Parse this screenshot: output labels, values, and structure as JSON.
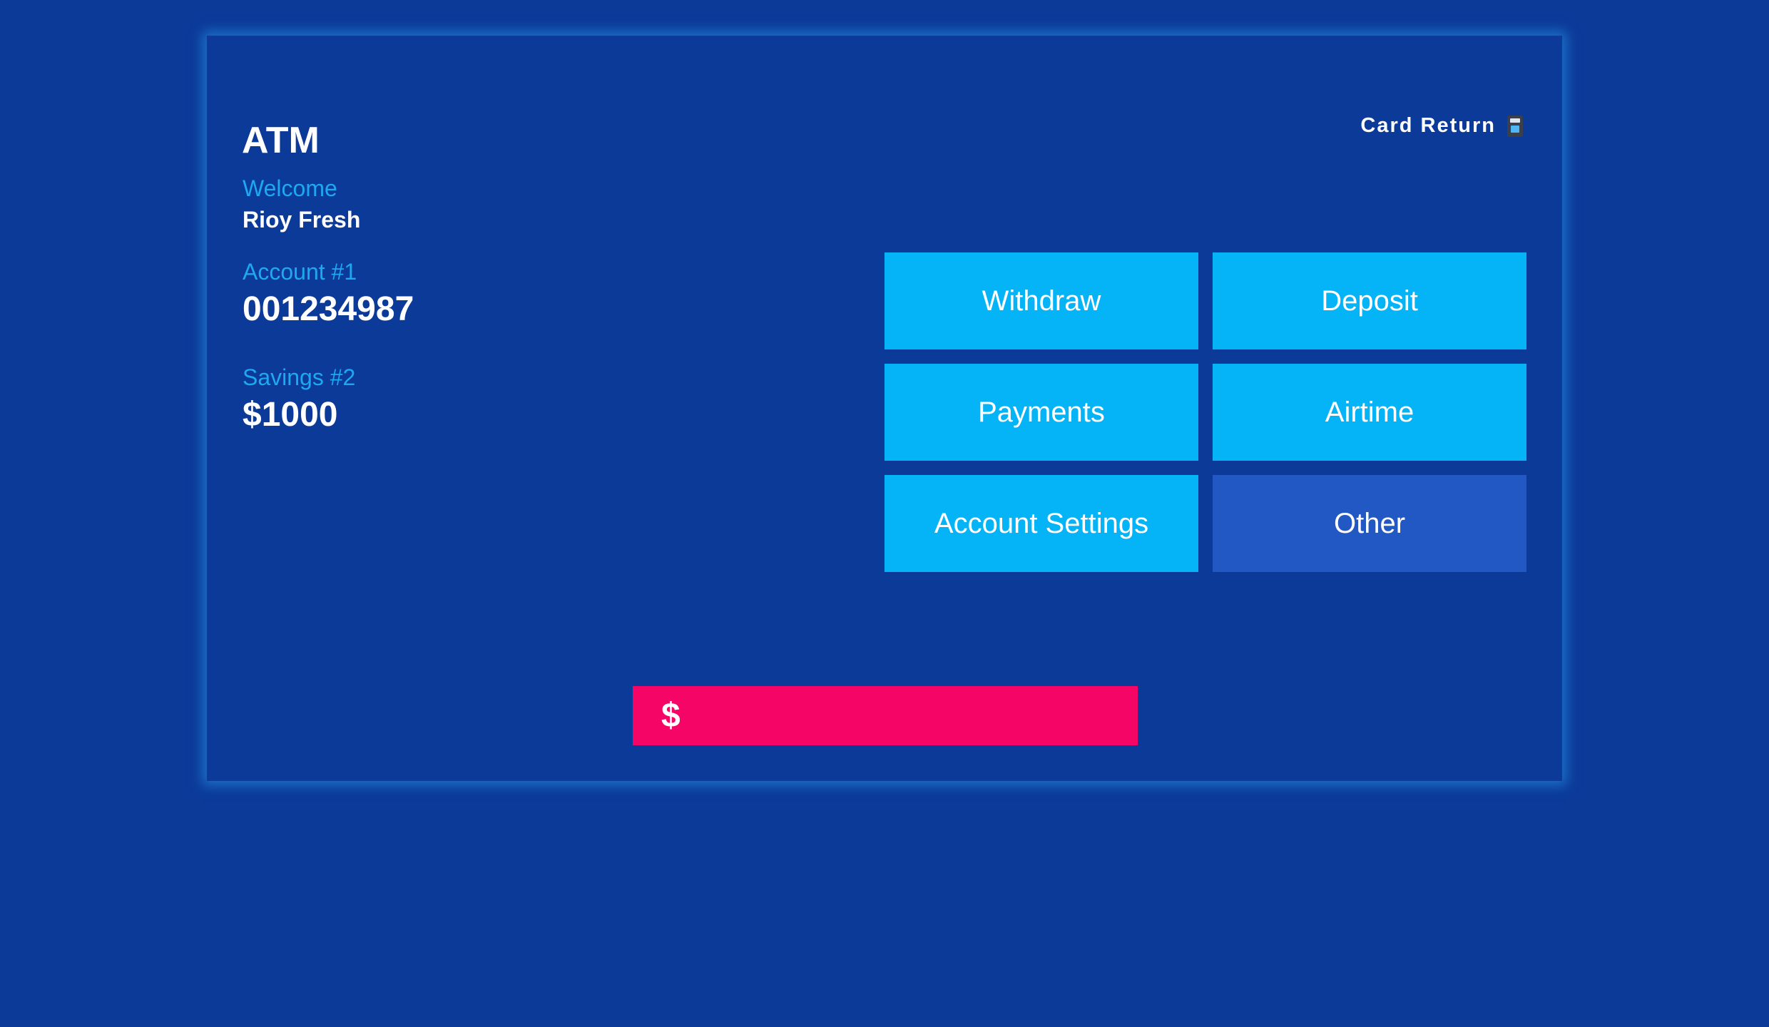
{
  "app": {
    "title": "ATM"
  },
  "header": {
    "card_return_label": "Card Return",
    "card_return_icon": "atm-card-icon"
  },
  "user": {
    "welcome_label": "Welcome",
    "name": "Rioy Fresh"
  },
  "accounts": {
    "primary_label": "Account #1",
    "primary_number": "001234987",
    "savings_label": "Savings #2",
    "savings_balance": "$1000"
  },
  "menu": {
    "items": [
      {
        "label": "Withdraw",
        "style": "primary"
      },
      {
        "label": "Deposit",
        "style": "primary"
      },
      {
        "label": "Payments",
        "style": "primary"
      },
      {
        "label": "Airtime",
        "style": "primary"
      },
      {
        "label": "Account Settings",
        "style": "primary"
      },
      {
        "label": "Other",
        "style": "secondary"
      }
    ]
  },
  "amount": {
    "currency_symbol": "$",
    "value": ""
  },
  "colors": {
    "background": "#0c3a99",
    "tile": "#05b4f6",
    "tile_other": "#2158c4",
    "amount_bar": "#f50566",
    "label": "#1ea8f1",
    "glow": "#28a0f0"
  }
}
